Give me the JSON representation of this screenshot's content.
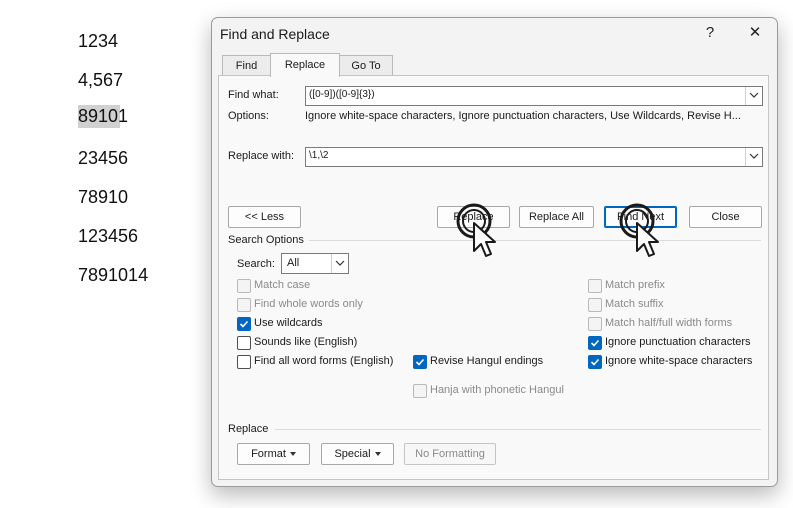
{
  "document": {
    "numbers": [
      "1234",
      "4,567",
      "89101",
      "23456",
      "78910",
      "123456",
      "7891014"
    ],
    "selected_index": 2
  },
  "dialog": {
    "title": "Find and Replace",
    "help_label": "?",
    "close_label": "✕",
    "tabs": [
      {
        "label": "Find",
        "active": false
      },
      {
        "label": "Replace",
        "active": true
      },
      {
        "label": "Go To",
        "active": false
      }
    ],
    "find_what_label": "Find what:",
    "find_what_value": "([0-9])([0-9]{3})",
    "options_label": "Options:",
    "options_value": "Ignore white-space characters, Ignore punctuation characters, Use Wildcards, Revise H...",
    "replace_with_label": "Replace with:",
    "replace_with_value": "\\1,\\2",
    "buttons": {
      "less": "<< Less",
      "replace": "Replace",
      "replace_all": "Replace All",
      "find_next": "Find Next",
      "close": "Close"
    },
    "search_options_title": "Search Options",
    "search_label": "Search:",
    "search_value": "All",
    "left_options": [
      {
        "label": "Match case",
        "checked": false,
        "disabled": true
      },
      {
        "label": "Find whole words only",
        "checked": false,
        "disabled": true
      },
      {
        "label": "Use wildcards",
        "checked": true,
        "disabled": false
      },
      {
        "label": "Sounds like (English)",
        "checked": false,
        "disabled": false
      },
      {
        "label": "Find all word forms (English)",
        "checked": false,
        "disabled": false
      }
    ],
    "right_options": [
      {
        "label": "Match prefix",
        "checked": false,
        "disabled": true
      },
      {
        "label": "Match suffix",
        "checked": false,
        "disabled": true
      },
      {
        "label": "Match half/full width forms",
        "checked": false,
        "disabled": true
      },
      {
        "label": "Ignore punctuation characters",
        "checked": true,
        "disabled": false
      },
      {
        "label": "Ignore white-space characters",
        "checked": true,
        "disabled": false
      }
    ],
    "middle_options": [
      {
        "label": "Revise Hangul endings",
        "checked": true,
        "disabled": false
      },
      {
        "label": "Hanja with phonetic Hangul",
        "checked": false,
        "disabled": true
      }
    ],
    "replace_section_title": "Replace",
    "format_label": "Format",
    "special_label": "Special",
    "no_formatting_label": "No Formatting"
  }
}
